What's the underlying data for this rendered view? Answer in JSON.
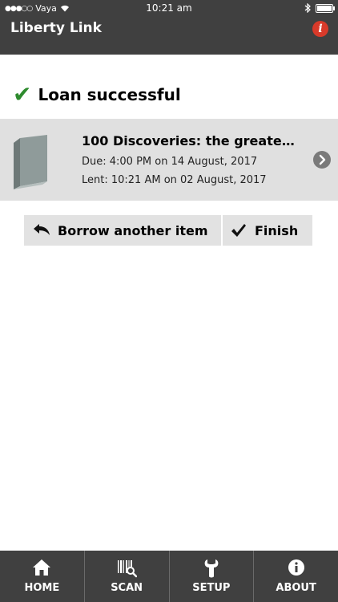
{
  "status_bar": {
    "carrier": "Vaya",
    "time": "10:21 am"
  },
  "header": {
    "title": "Liberty Link",
    "info_icon": "info-icon"
  },
  "message": {
    "text": "Loan successful",
    "check_color": "#2e8b2e"
  },
  "loan": {
    "title": "100 Discoveries: the greate…",
    "due": "Due: 4:00 PM on 14 August, 2017",
    "lent": "Lent: 10:21 AM on 02 August, 2017"
  },
  "actions": {
    "borrow_label": "Borrow another item",
    "finish_label": "Finish"
  },
  "tabs": [
    {
      "label": "HOME",
      "icon": "home-icon"
    },
    {
      "label": "SCAN",
      "icon": "barcode-icon"
    },
    {
      "label": "SETUP",
      "icon": "wrench-icon"
    },
    {
      "label": "ABOUT",
      "icon": "info-icon"
    }
  ],
  "colors": {
    "bar": "#404040",
    "accent_red": "#d83a2a",
    "card_bg": "#e0e0e0"
  }
}
